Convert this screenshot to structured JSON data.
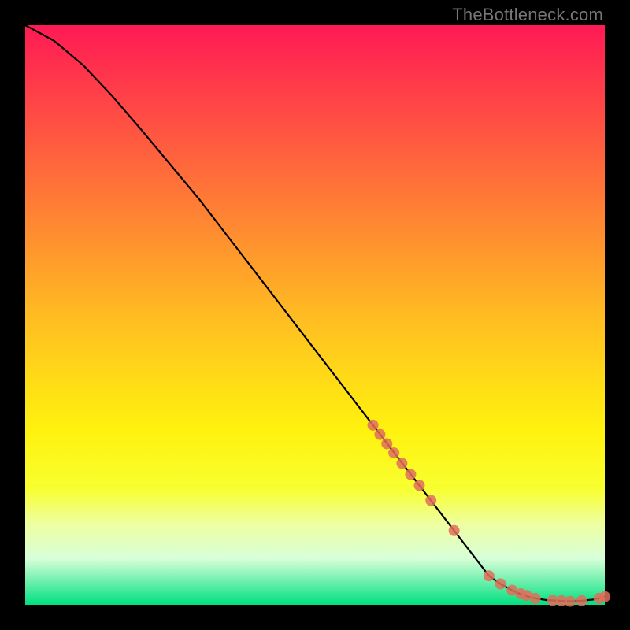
{
  "watermark": "TheBottleneck.com",
  "chart_data": {
    "type": "line",
    "title": "",
    "xlabel": "",
    "ylabel": "",
    "xlim": [
      0,
      100
    ],
    "ylim": [
      0,
      100
    ],
    "grid": false,
    "legend": false,
    "series": [
      {
        "name": "curve",
        "x": [
          0,
          5,
          10,
          15,
          20,
          25,
          30,
          35,
          40,
          45,
          50,
          55,
          60,
          62,
          65,
          68,
          70,
          73,
          76,
          78,
          80,
          82,
          84,
          86,
          88,
          90,
          92,
          94,
          96,
          98,
          100
        ],
        "y": [
          100,
          97.3,
          93.1,
          87.8,
          82.0,
          76.0,
          70.0,
          63.5,
          57.0,
          50.5,
          44.0,
          37.5,
          31.0,
          28.4,
          24.5,
          20.6,
          18.0,
          14.1,
          10.2,
          7.6,
          5.0,
          3.6,
          2.5,
          1.6,
          1.1,
          0.8,
          0.7,
          0.6,
          0.7,
          0.9,
          1.4
        ]
      }
    ],
    "scatter_points": {
      "name": "markers",
      "style": "coral-dots",
      "x": [
        60,
        61.2,
        62.4,
        63.6,
        65.0,
        66.5,
        68.0,
        70.0,
        74.0,
        80.0,
        82.0,
        84.0,
        85.5,
        86.5,
        88.0,
        91.0,
        92.5,
        94.0,
        96.0,
        99.0,
        100.0
      ],
      "y": [
        31.0,
        29.4,
        27.8,
        26.2,
        24.4,
        22.5,
        20.6,
        18.0,
        12.8,
        5.0,
        3.6,
        2.5,
        1.9,
        1.6,
        1.1,
        0.75,
        0.7,
        0.6,
        0.7,
        1.1,
        1.4
      ]
    }
  }
}
